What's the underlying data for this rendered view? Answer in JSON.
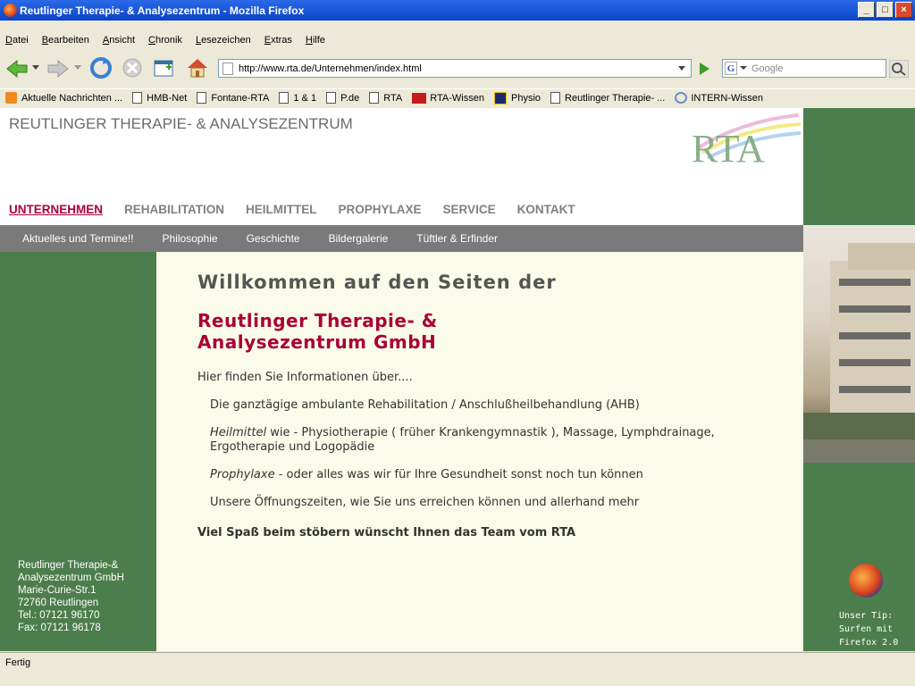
{
  "window": {
    "title": "Reutlinger Therapie- & Analysezentrum - Mozilla Firefox"
  },
  "menu": [
    "Datei",
    "Bearbeiten",
    "Ansicht",
    "Chronik",
    "Lesezeichen",
    "Extras",
    "Hilfe"
  ],
  "address": {
    "url": "http://www.rta.de/Unternehmen/index.html"
  },
  "search": {
    "placeholder": "Google"
  },
  "bookmarks": [
    "Aktuelle Nachrichten ...",
    "HMB-Net",
    "Fontane-RTA",
    "1 & 1",
    "P.de",
    "RTA",
    "RTA-Wissen",
    "Physio",
    "Reutlinger Therapie- ...",
    "INTERN-Wissen"
  ],
  "site": {
    "name": "REUTLINGER THERAPIE- & ANALYSEZENTRUM",
    "logo": "RTA",
    "nav": [
      "UNTERNEHMEN",
      "REHABILITATION",
      "HEILMITTEL",
      "PROPHYLAXE",
      "SERVICE",
      "KONTAKT"
    ],
    "subnav": [
      "Aktuelles und Termine!!",
      "Philosophie",
      "Geschichte",
      "Bildergalerie",
      "Tüftler & Erfinder"
    ],
    "content": {
      "heading": "Willkommen auf den Seiten der",
      "company_line1": "Reutlinger Therapie- &",
      "company_line2": "Analysezentrum GmbH",
      "intro": "Hier finden Sie Informationen über....",
      "item1": "Die ganztägige ambulante Rehabilitation / Anschlußheilbehandlung (AHB)",
      "item2_em": "Heilmittel",
      "item2_rest": " wie - Physiotherapie ( früher Krankengymnastik ), Massage, Lymphdrainage, Ergotherapie und Logopädie",
      "item3_em": "Prophylaxe",
      "item3_rest": " - oder alles was wir für Ihre Gesundheit sonst noch tun können",
      "item4": "Unsere Öffnungszeiten, wie Sie uns erreichen können und allerhand mehr",
      "closing": "Viel Spaß beim stöbern wünscht Ihnen das Team vom RTA"
    },
    "address_lines": [
      "Reutlinger Therapie-&",
      "Analysezentrum GmbH",
      "Marie-Curie-Str.1",
      "72760 Reutlingen",
      "Tel.: 07121 96170",
      "Fax: 07121 96178"
    ],
    "tip_lines": [
      "Unser Tip:",
      "Surfen mit",
      "Firefox 2.0"
    ]
  },
  "status": {
    "text": "Fertig"
  },
  "colors": {
    "accent": "#b00038",
    "green": "#4c7d4c"
  }
}
